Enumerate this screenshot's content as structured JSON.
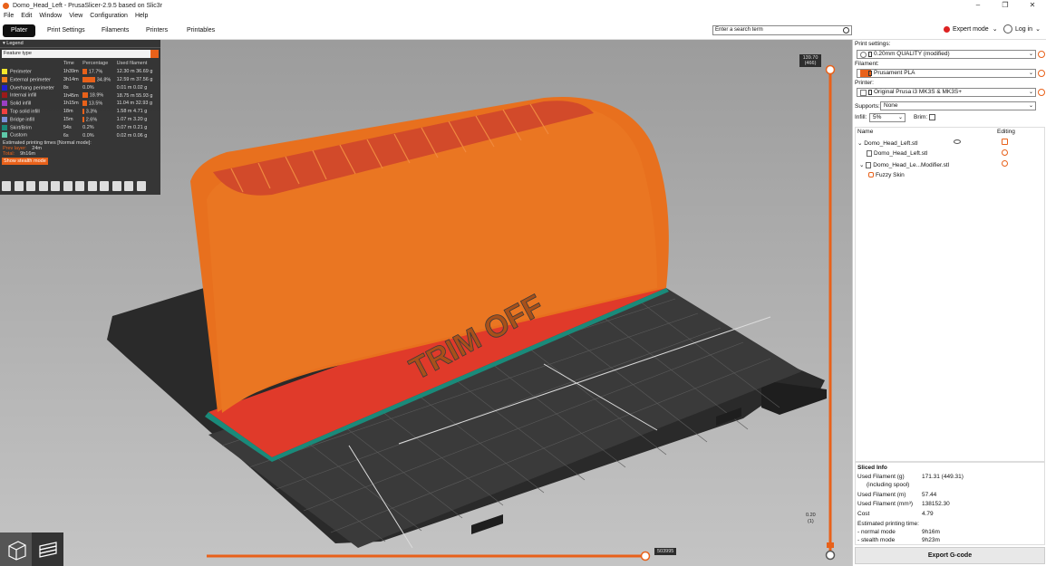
{
  "window": {
    "title": "Domo_Head_Left - PrusaSlicer-2.9.5 based on Slic3r"
  },
  "menu": [
    "File",
    "Edit",
    "Window",
    "View",
    "Configuration",
    "Help"
  ],
  "tabs": [
    "Plater",
    "Print Settings",
    "Filaments",
    "Printers",
    "Printables"
  ],
  "search": {
    "placeholder": "Enter a search term"
  },
  "mode": {
    "label": "Expert mode"
  },
  "login": {
    "label": "Log in"
  },
  "legend": {
    "title": "Legend",
    "select": "Feature type",
    "headers": [
      "",
      "Time",
      "Percentage",
      "Used filament"
    ],
    "rows": [
      {
        "name": "Perimeter",
        "color": "#f5e72c",
        "time": "1h39m",
        "pct": "17.7%",
        "len": "12.30 m",
        "weight": "36.69 g"
      },
      {
        "name": "External perimeter",
        "color": "#f0801e",
        "time": "3h14m",
        "pct": "34.8%",
        "len": "12.59 m",
        "weight": "37.56 g"
      },
      {
        "name": "Overhang perimeter",
        "color": "#2020d0",
        "time": "8s",
        "pct": "0.0%",
        "len": "0.01 m",
        "weight": "0.02 g"
      },
      {
        "name": "Internal infill",
        "color": "#9c1a1a",
        "time": "1h45m",
        "pct": "18.9%",
        "len": "18.75 m",
        "weight": "55.93 g"
      },
      {
        "name": "Solid infill",
        "color": "#9b3fc4",
        "time": "1h15m",
        "pct": "13.5%",
        "len": "11.04 m",
        "weight": "32.93 g"
      },
      {
        "name": "Top solid infill",
        "color": "#f04040",
        "time": "18m",
        "pct": "3.3%",
        "len": "1.58 m",
        "weight": "4.71 g"
      },
      {
        "name": "Bridge infill",
        "color": "#7a8fd8",
        "time": "15m",
        "pct": "2.6%",
        "len": "1.07 m",
        "weight": "3.20 g"
      },
      {
        "name": "Skirt/Brim",
        "color": "#1a8a7a",
        "time": "54s",
        "pct": "0.2%",
        "len": "0.07 m",
        "weight": "0.21 g"
      },
      {
        "name": "Custom",
        "color": "#5ec8a8",
        "time": "6s",
        "pct": "0.0%",
        "len": "0.02 m",
        "weight": "0.06 g"
      }
    ],
    "estimated": "Estimated printing times [Normal mode]:",
    "prev_layer_label": "Prev layer:",
    "prev_layer": "24m",
    "total_label": "Total:",
    "total": "9h16m",
    "stealth_button": "Show stealth mode"
  },
  "vslider": {
    "top": "139.70",
    "top_layer": "(466)",
    "bottom": "0.20",
    "bottom_layer": "(1)"
  },
  "hslider": {
    "value": "503995"
  },
  "plate_text": "TRIM OFF",
  "right": {
    "print_settings_label": "Print settings:",
    "print_settings": "0.20mm QUALITY (modified)",
    "filament_label": "Filament:",
    "filament": "Prusament PLA",
    "filament_color": "#e8611a",
    "printer_label": "Printer:",
    "printer": "Original Prusa i3 MK3S & MK3S+",
    "supports_label": "Supports:",
    "supports": "None",
    "infill_label": "Infill:",
    "infill": "5%",
    "brim_label": "Brim:",
    "col_name": "Name",
    "col_editing": "Editing",
    "objects": [
      "Domo_Head_Left.stl",
      "Domo_Head_Left.stl",
      "Domo_Head_Le...Modifier.stl",
      "Fuzzy Skin"
    ]
  },
  "sliced": {
    "title": "Sliced Info",
    "rows": [
      {
        "label": "Used Filament (g)",
        "value": "171.31 (449.31)"
      },
      {
        "label": "(including spool)",
        "value": ""
      },
      {
        "label": "Used Filament (m)",
        "value": "57.44"
      },
      {
        "label": "Used Filament (mm³)",
        "value": "138152.30"
      },
      {
        "label": "Cost",
        "value": "4.79"
      },
      {
        "label": "Estimated printing time:",
        "value": ""
      },
      {
        "label": "- normal mode",
        "value": "9h16m"
      },
      {
        "label": "- stealth mode",
        "value": "9h23m"
      }
    ],
    "export_button": "Export G-code"
  }
}
